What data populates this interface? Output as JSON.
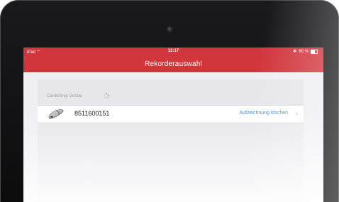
{
  "status_bar": {
    "carrier": "iPad",
    "wifi_icon": "wifi-icon",
    "time": "13:17",
    "bluetooth_icon": "bluetooth-icon",
    "battery": "60 %",
    "battery_icon": "battery-icon"
  },
  "navbar": {
    "title": "Rekorderauswahl"
  },
  "section": {
    "label": "CardioSnip Geräte",
    "spinner_icon": "loading-spinner-icon"
  },
  "devices": [
    {
      "icon": "recorder-device-icon",
      "number": "8511600151",
      "action": "Aufzeichnung löschen",
      "chevron_icon": "chevron-right-icon"
    }
  ],
  "colors": {
    "accent": "#d1363d",
    "link": "#3a8ed6",
    "background": "#efeff4"
  }
}
